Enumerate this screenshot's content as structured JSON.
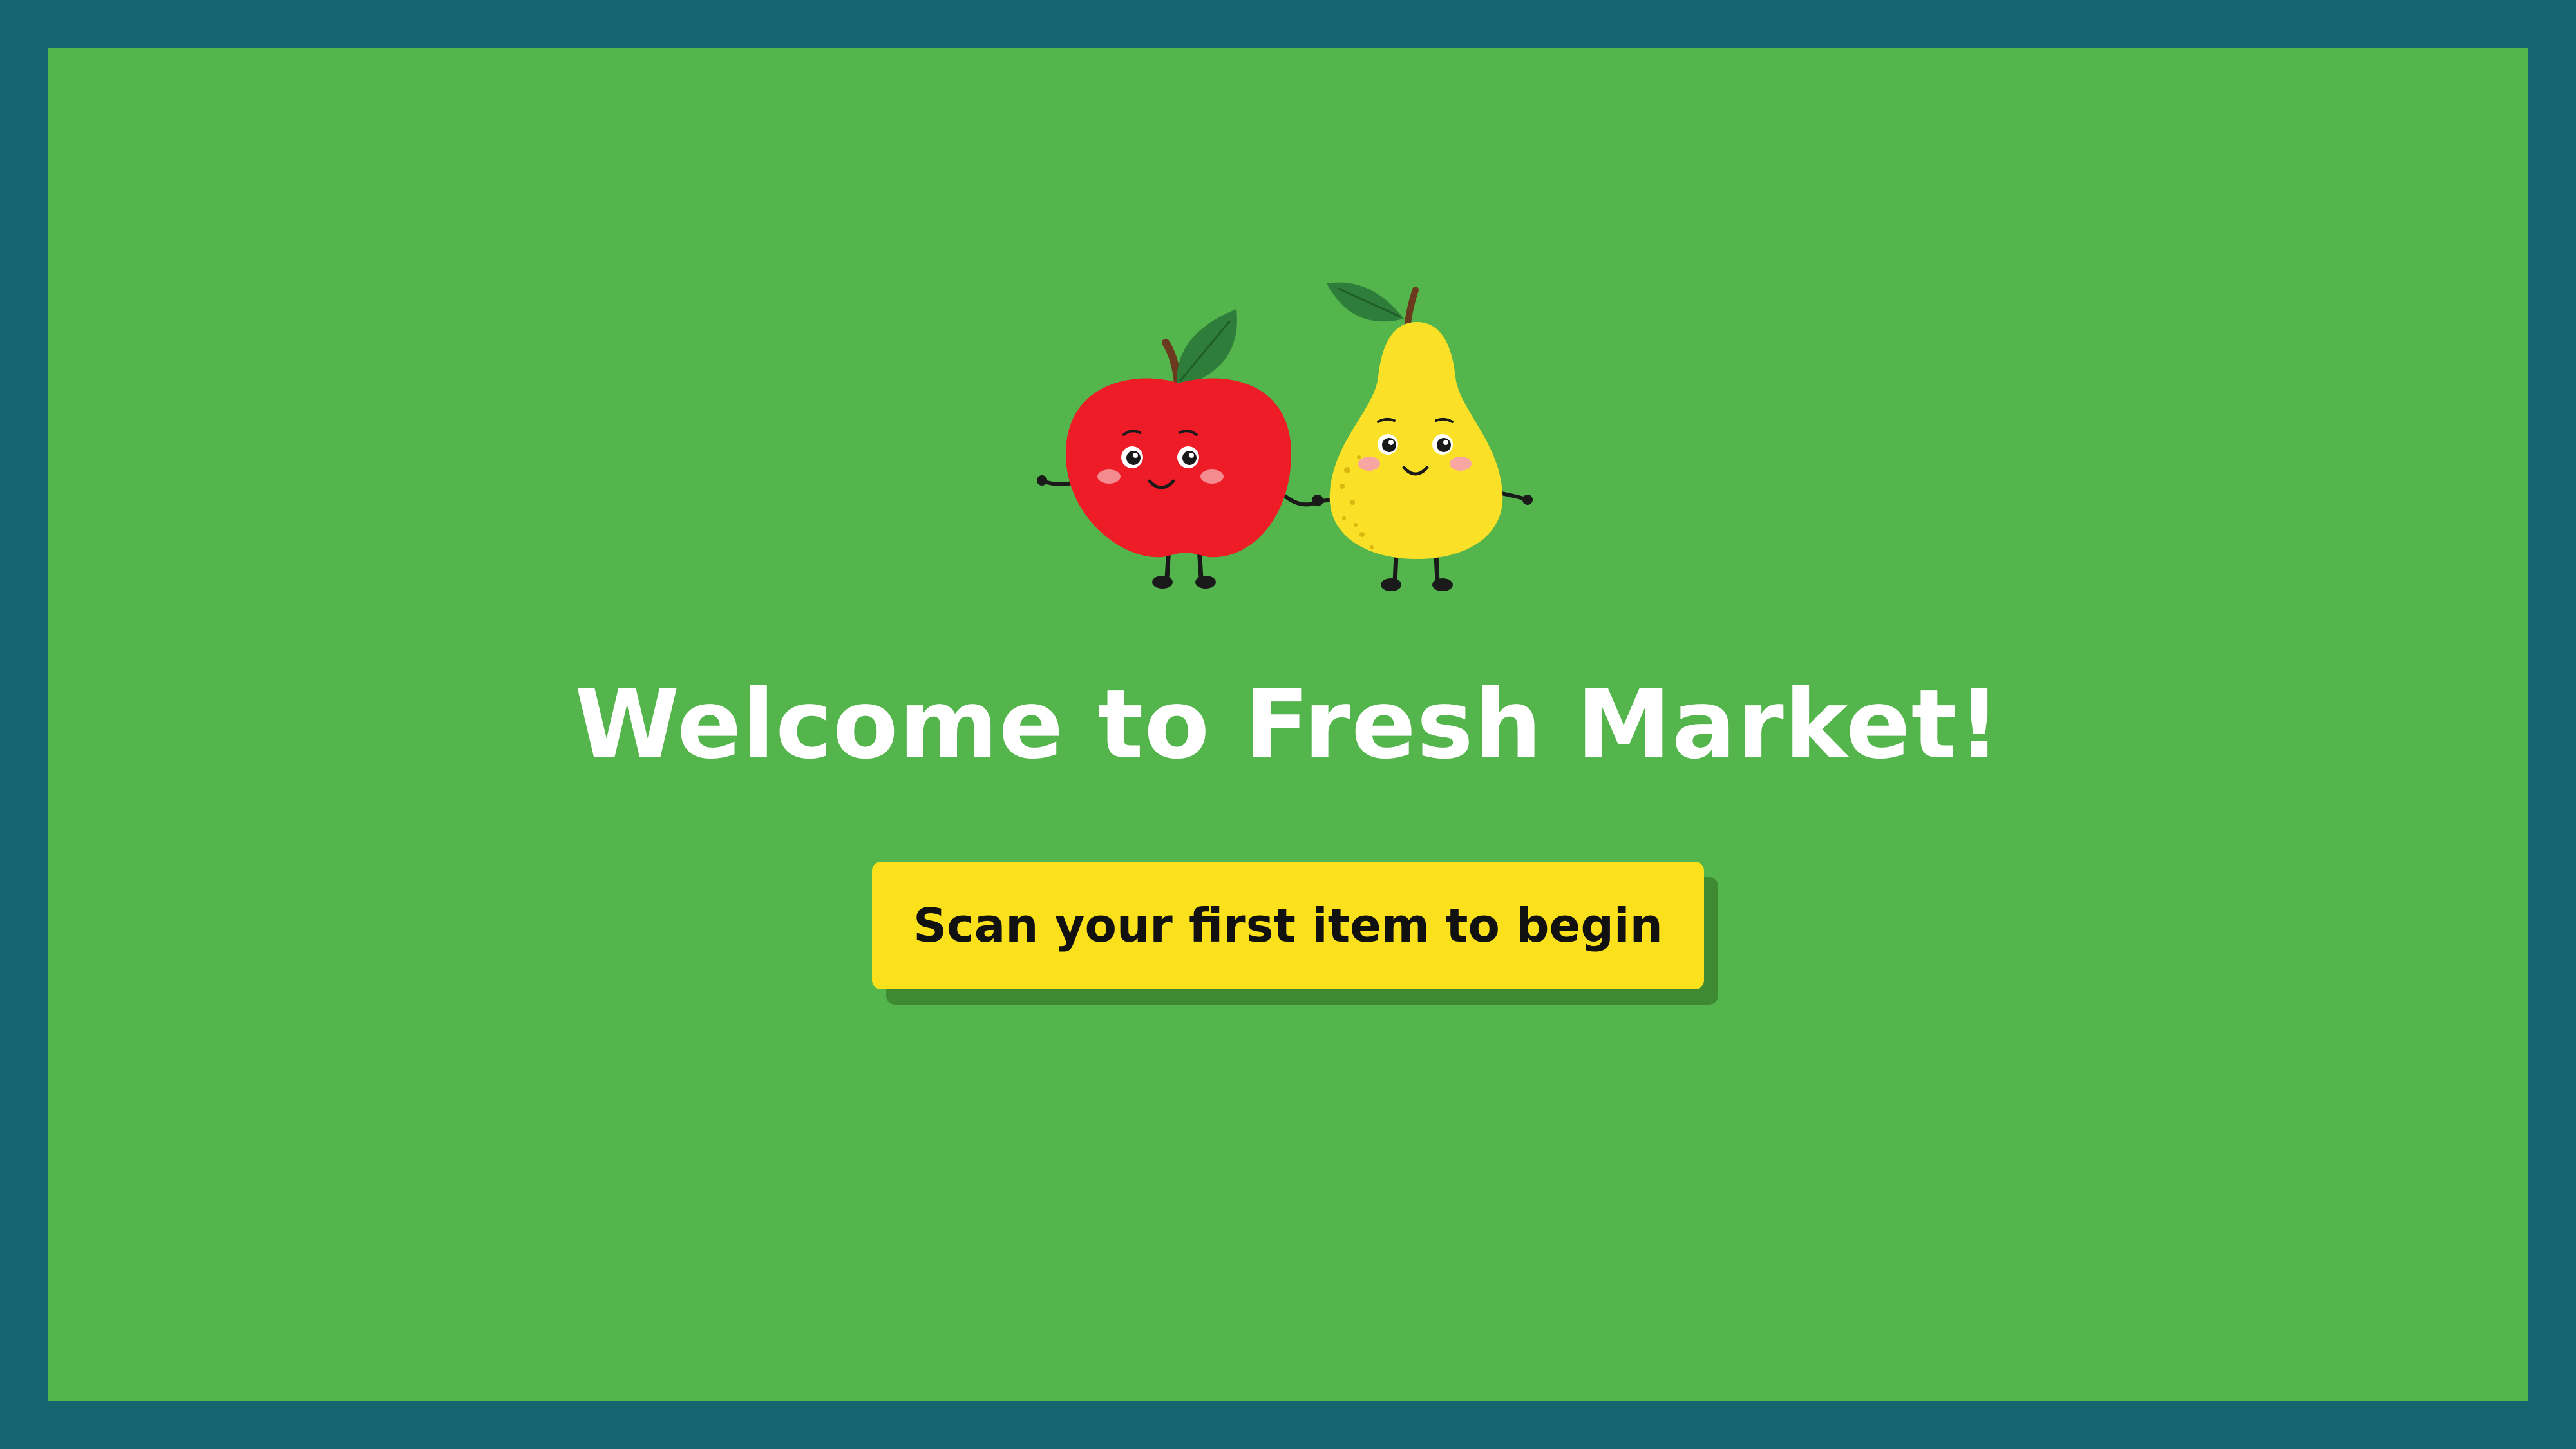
{
  "screen": {
    "title": "Welcome to Fresh Market!",
    "action_label": "Scan your first item to begin"
  },
  "illustration": {
    "characters": [
      "apple-icon",
      "pear-icon"
    ]
  },
  "colors": {
    "frame": "#15646f",
    "background": "#53b54b",
    "button": "#fbe01c",
    "button_shadow": "#3e8a33",
    "apple": "#ee1c27",
    "pear": "#fbe028",
    "leaf": "#2e7d3a"
  }
}
